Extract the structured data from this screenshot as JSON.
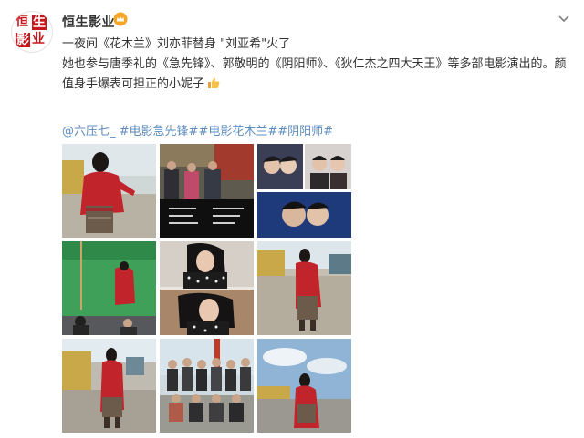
{
  "post": {
    "username": "恒生影业",
    "logo_text": [
      "恒",
      "生",
      "影",
      "业"
    ],
    "text_line1": "一夜间《花木兰》刘亦菲替身 \"刘亚希\"火了",
    "text_line2": "她也参与唐季礼的《急先锋》、郭敬明的《阴阳师》、《狄仁杰之四大天王》等多部电影演出的。颜值身手爆表可担正的小妮子",
    "mention": "@六压七_",
    "hashtags": [
      "#电影急先锋#",
      "#电影花木兰#",
      "#阴阳师#"
    ]
  },
  "colors": {
    "link": "#5d8cbf",
    "brand_red": "#c8161d",
    "text": "#333333"
  },
  "icons": {
    "crown": "crown-icon",
    "menu": "chevron-down-icon",
    "thumbs_up": "thumbs-up-icon"
  },
  "photos": [
    {
      "name": "photo-1-red-costume-field"
    },
    {
      "name": "photo-2-group-and-credits"
    },
    {
      "name": "photo-3-selfie-collage"
    },
    {
      "name": "photo-4-greenscreen-set"
    },
    {
      "name": "photo-5-polka-dot-dress"
    },
    {
      "name": "photo-6-red-costume-side"
    },
    {
      "name": "photo-7-red-costume-containers"
    },
    {
      "name": "photo-8-crew-group"
    },
    {
      "name": "photo-9-red-costume-tarmac"
    }
  ]
}
